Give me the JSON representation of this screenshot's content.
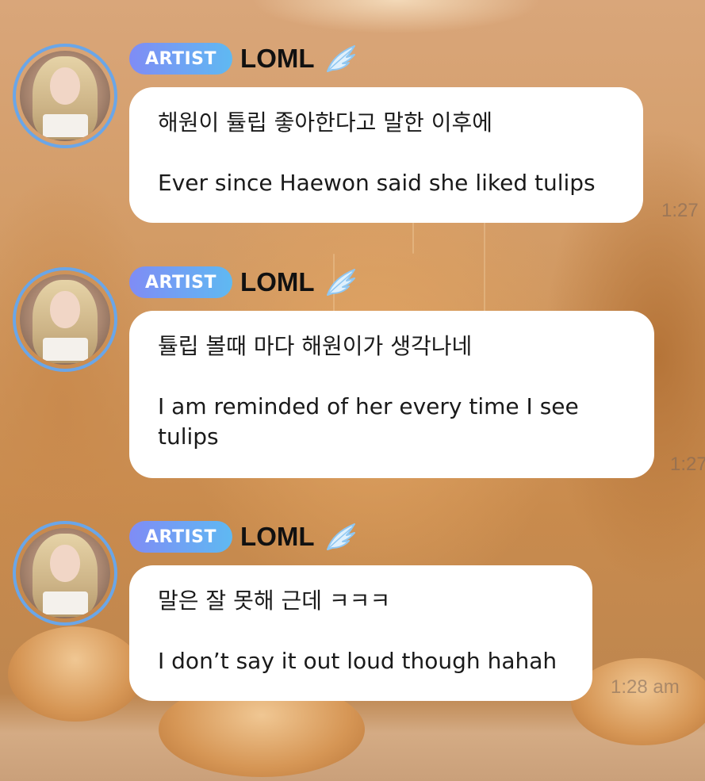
{
  "messages": [
    {
      "badge": "ARTIST",
      "name": "LOML",
      "korean": "해원이 튤립 좋아한다고 말한 이후에",
      "english": "Ever since Haewon said she liked tulips",
      "time": "1:27"
    },
    {
      "badge": "ARTIST",
      "name": "LOML",
      "korean": "튤립 볼때 마다 해원이가 생각나네",
      "english": "I am reminded of her every time I see tulips",
      "time": "1:27"
    },
    {
      "badge": "ARTIST",
      "name": "LOML",
      "korean": "말은 잘 못해 근데 ㅋㅋㅋ",
      "english": "I don’t say it out loud though hahah",
      "time": "1:28 am"
    }
  ],
  "colors": {
    "badge_start": "#7f8cf5",
    "badge_end": "#5fb9f2",
    "avatar_ring": "#6aa6e8",
    "bubble": "#ffffff",
    "wing": "#8fc7f2"
  },
  "icons": {
    "badge_icon": "wing-icon"
  }
}
